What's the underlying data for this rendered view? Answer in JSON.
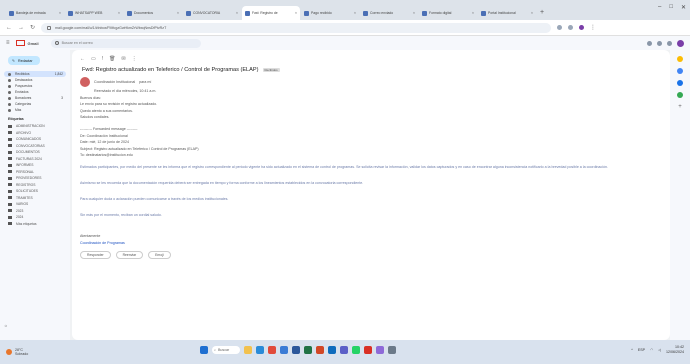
{
  "tabs": [
    {
      "label": "Bandeja de entrada",
      "active": false
    },
    {
      "label": "WHATSAPP WEB",
      "active": false
    },
    {
      "label": "Documentos",
      "active": false
    },
    {
      "label": "CONVOCATORIA",
      "active": false
    },
    {
      "label": "Fwd: Registro de",
      "active": true
    },
    {
      "label": "Pago recibido",
      "active": false
    },
    {
      "label": "Correo enviado",
      "active": false
    },
    {
      "label": "Formato digital",
      "active": false
    },
    {
      "label": "Portal Institucional",
      "active": false
    }
  ],
  "url": "mail.google.com/mail/u/1/#inbox/FMfcgzGwHkmZrWbxqNnsDfPtvRzT",
  "search_placeholder": "Buscar en el correo",
  "gmail_label": "Gmail",
  "compose_label": "Redactar",
  "sidebar_items": [
    {
      "label": "Recibidos",
      "count": "1,842",
      "active": true
    },
    {
      "label": "Destacados",
      "count": "",
      "active": false
    },
    {
      "label": "Pospuestos",
      "count": "",
      "active": false
    },
    {
      "label": "Enviados",
      "count": "",
      "active": false
    },
    {
      "label": "Borradores",
      "count": "3",
      "active": false
    },
    {
      "label": "Categorías",
      "count": "",
      "active": false
    },
    {
      "label": "Más",
      "count": "",
      "active": false
    }
  ],
  "labels_heading": "Etiquetas",
  "labels": [
    "ADMINISTRACION",
    "ARCHIVO",
    "COMUNICADOS",
    "CONVOCATORIAS",
    "DOCUMENTOS",
    "FACTURAS 2024",
    "INFORMES",
    "PERSONAL",
    "PROVEEDORES",
    "REGISTROS",
    "SOLICITUDES",
    "TRAMITES",
    "VARIOS",
    "2023",
    "2024",
    "Más etiquetas"
  ],
  "email": {
    "subject": "Fwd: Registro actualizado en Teleferico / Control de Programas (ELAP)",
    "chip": "Recibidos",
    "sender": "Coordinación Institucional",
    "sender_meta": "para mí",
    "forward_note": "Reenviado el día miércoles, 10:41 a.m.",
    "lines": [
      "Buenos días:",
      "Le envío para su revisión el registro actualizado.",
      "Quedo atento a sus comentarios.",
      "Saludos cordiales."
    ],
    "fwd_header": [
      "---------- Forwarded message ---------",
      "De: Coordinación Institucional",
      "Date: mié, 12 de junio de 2024",
      "Subject: Registro actualizado en Teleferico / Control de Programas (ELAP)",
      "To: destinatarios@institucion.edu"
    ],
    "paragraphs": [
      "Estimados participantes, por medio del presente se les informa que el registro correspondiente al periodo vigente ha sido actualizado en el sistema de control de programas. Se solicita revisar la información, validar los datos capturados y en caso de encontrar alguna inconsistencia notificarlo a la brevedad posible a la coordinación.",
      "Asimismo se les recuerda que la documentación requerida deberá ser entregada en tiempo y forma conforme a los lineamientos establecidos en la convocatoria correspondiente.",
      "Para cualquier duda o aclaración pueden comunicarse a través de los medios institucionales.",
      "Sin más por el momento, reciban un cordial saludo."
    ],
    "sign": "Atentamente",
    "footer": "Coordinación de Programas"
  },
  "reply_buttons": [
    "Responder",
    "Reenviar",
    "Emoji"
  ],
  "taskbar": {
    "weather_temp": "28°C",
    "weather_text": "Soleado",
    "search_label": "Buscar",
    "time": "10:42",
    "date": "12/06/2024",
    "lang": "ESP"
  },
  "colors": {
    "accent": "#c2e7ff",
    "brand": "#d93025",
    "link": "#1a4fc0"
  }
}
